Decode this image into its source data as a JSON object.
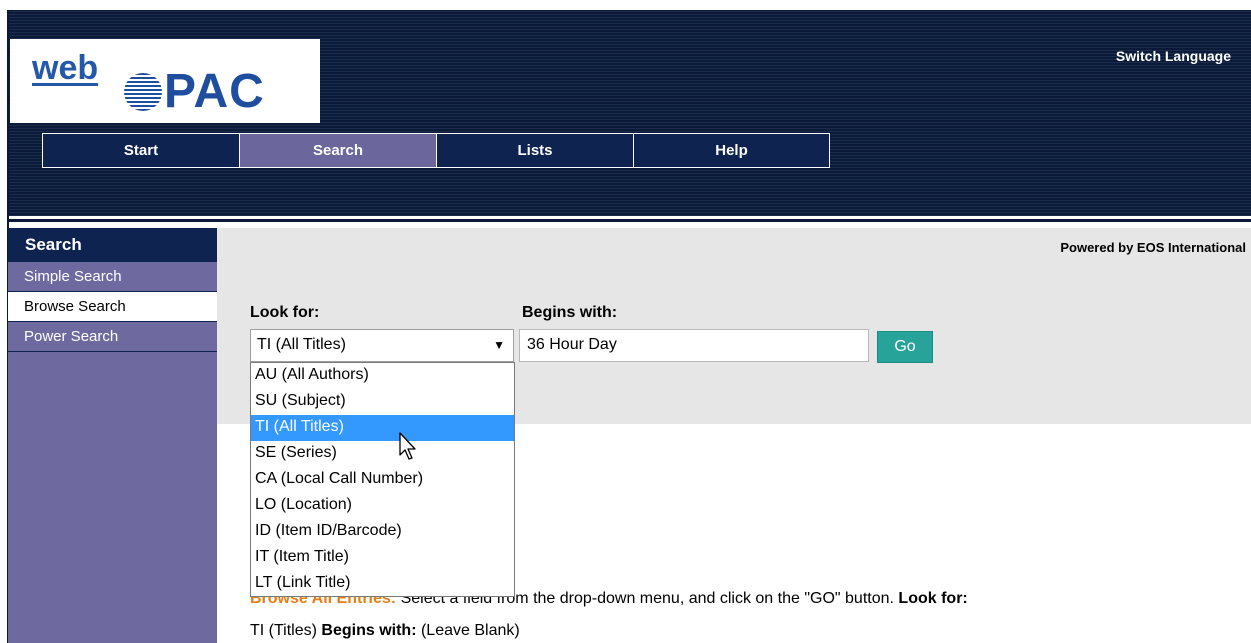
{
  "header": {
    "logo_web": "web",
    "logo_opac": "PAC",
    "switch_language": "Switch Language"
  },
  "nav": {
    "tabs": [
      {
        "label": "Start",
        "active": false
      },
      {
        "label": "Search",
        "active": true
      },
      {
        "label": "Lists",
        "active": false
      },
      {
        "label": "Help",
        "active": false
      }
    ]
  },
  "sidebar": {
    "heading": "Search",
    "items": [
      {
        "label": "Simple Search",
        "active": false
      },
      {
        "label": "Browse Search",
        "active": true
      },
      {
        "label": "Power Search",
        "active": false
      }
    ]
  },
  "main": {
    "powered_by": "Powered by EOS International",
    "look_for_label": "Look for:",
    "begins_with_label": "Begins with:",
    "select_value": "TI (All Titles)",
    "input_value": "36 Hour Day",
    "go_label": "Go",
    "dropdown_options": [
      "AU (All Authors)",
      "SU (Subject)",
      "TI (All Titles)",
      "SE (Series)",
      "CA (Local Call Number)",
      "LO (Location)",
      "ID (Item ID/Barcode)",
      "IT (Item Title)",
      "LT (Link Title)"
    ],
    "highlighted_option": "TI (All Titles)",
    "help": {
      "heading": "Browse All Entries:",
      "text1": "Select a field from the drop-down menu, and click on the \"GO\" button.",
      "look_for": "Look for:",
      "line2_value1": "TI (Titles)",
      "begins_with": "Begins with:",
      "line2_value2": "(Leave Blank)"
    }
  },
  "colors": {
    "header_navy": "#0b1a38",
    "active_tab": "#6b679c",
    "sidebar_purple": "#6e6aa0",
    "go_button": "#27a39a",
    "highlight_blue": "#3399ff",
    "help_orange": "#e57f14"
  }
}
